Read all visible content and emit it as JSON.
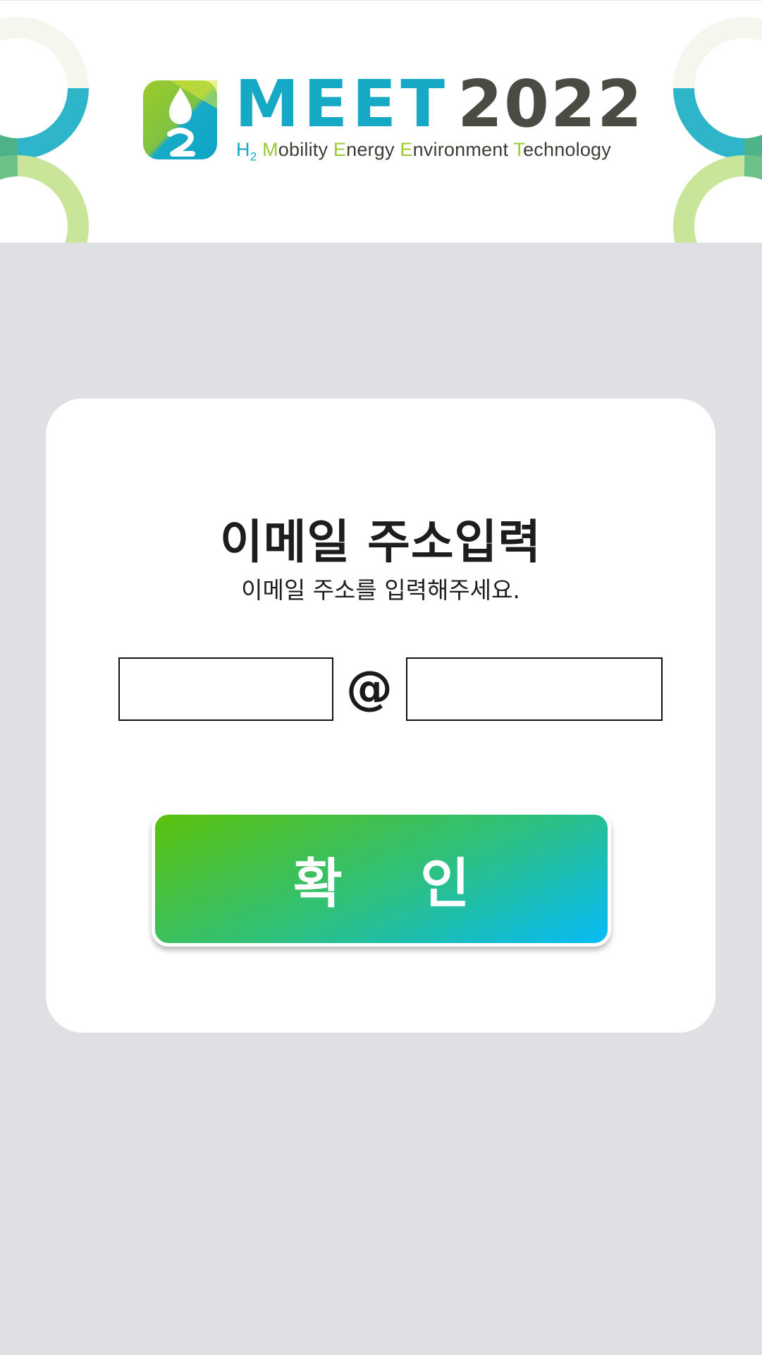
{
  "header": {
    "logo": {
      "title_main": "MEET",
      "title_year": "2022",
      "tagline": {
        "h": "H",
        "sub": "2",
        "m": "M",
        "obility": "obility ",
        "e1": "E",
        "nergy": "nergy ",
        "e2": "E",
        "nvironment": "nvironment ",
        "t": "T",
        "echnology": "echnology"
      }
    }
  },
  "card": {
    "title": "이메일 주소입력",
    "subtitle": "이메일 주소를 입력해주세요.",
    "email": {
      "local_value": "",
      "local_placeholder": "",
      "at_symbol": "@",
      "domain_value": "",
      "domain_placeholder": ""
    },
    "confirm_label": "확 인"
  },
  "colors": {
    "background": "#dfe0e4",
    "brand_teal": "#16a9c6",
    "brand_green": "#9acb2d",
    "brand_dark": "#4b4b44",
    "button_gradient_start": "#5bc10c",
    "button_gradient_end": "#06bbf7"
  },
  "icons": {
    "logo_mark": "h2-droplet-logo-icon",
    "decoration": "ring-decoration"
  }
}
